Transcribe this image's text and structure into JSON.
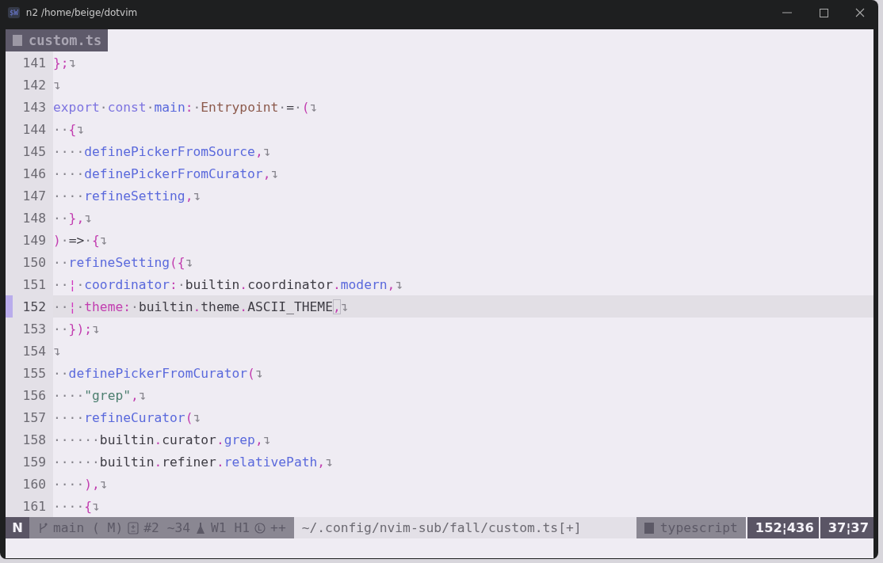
{
  "window": {
    "app_badge": "$W",
    "title": "n2 /home/beige/dotvim"
  },
  "tabs": [
    {
      "label": "custom.ts",
      "selected": true
    }
  ],
  "editor": {
    "lines": [
      {
        "number": "141",
        "current": false,
        "tokens": [
          {
            "kind": "p",
            "text": "};"
          },
          {
            "kind": "w",
            "text": "↴"
          }
        ]
      },
      {
        "number": "142",
        "current": false,
        "tokens": [
          {
            "kind": "w",
            "text": "↴"
          }
        ]
      },
      {
        "number": "143",
        "current": false,
        "tokens": [
          {
            "kind": "k",
            "text": "export"
          },
          {
            "kind": "w",
            "text": "·"
          },
          {
            "kind": "k",
            "text": "const"
          },
          {
            "kind": "w",
            "text": "·"
          },
          {
            "kind": "f",
            "text": "main"
          },
          {
            "kind": "p",
            "text": ":"
          },
          {
            "kind": "w",
            "text": "·"
          },
          {
            "kind": "t",
            "text": "Entrypoint"
          },
          {
            "kind": "w",
            "text": "·"
          },
          {
            "kind": "n",
            "text": "="
          },
          {
            "kind": "w",
            "text": "·"
          },
          {
            "kind": "p",
            "text": "("
          },
          {
            "kind": "w",
            "text": "↴"
          }
        ]
      },
      {
        "number": "144",
        "current": false,
        "tokens": [
          {
            "kind": "w",
            "text": "··"
          },
          {
            "kind": "p",
            "text": "{"
          },
          {
            "kind": "w",
            "text": "↴"
          }
        ]
      },
      {
        "number": "145",
        "current": false,
        "tokens": [
          {
            "kind": "w",
            "text": "····"
          },
          {
            "kind": "f",
            "text": "definePickerFromSource"
          },
          {
            "kind": "p",
            "text": ","
          },
          {
            "kind": "w",
            "text": "↴"
          }
        ]
      },
      {
        "number": "146",
        "current": false,
        "tokens": [
          {
            "kind": "w",
            "text": "····"
          },
          {
            "kind": "f",
            "text": "definePickerFromCurator"
          },
          {
            "kind": "p",
            "text": ","
          },
          {
            "kind": "w",
            "text": "↴"
          }
        ]
      },
      {
        "number": "147",
        "current": false,
        "tokens": [
          {
            "kind": "w",
            "text": "····"
          },
          {
            "kind": "f",
            "text": "refineSetting"
          },
          {
            "kind": "p",
            "text": ","
          },
          {
            "kind": "w",
            "text": "↴"
          }
        ]
      },
      {
        "number": "148",
        "current": false,
        "tokens": [
          {
            "kind": "w",
            "text": "··"
          },
          {
            "kind": "p",
            "text": "},"
          },
          {
            "kind": "w",
            "text": "↴"
          }
        ]
      },
      {
        "number": "149",
        "current": false,
        "tokens": [
          {
            "kind": "p",
            "text": ")"
          },
          {
            "kind": "w",
            "text": "·"
          },
          {
            "kind": "n",
            "text": "=>"
          },
          {
            "kind": "w",
            "text": "·"
          },
          {
            "kind": "p",
            "text": "{"
          },
          {
            "kind": "w",
            "text": "↴"
          }
        ]
      },
      {
        "number": "150",
        "current": false,
        "tokens": [
          {
            "kind": "w",
            "text": "··"
          },
          {
            "kind": "f",
            "text": "refineSetting"
          },
          {
            "kind": "p",
            "text": "({"
          },
          {
            "kind": "w",
            "text": "↴"
          }
        ]
      },
      {
        "number": "151",
        "current": false,
        "tokens": [
          {
            "kind": "w",
            "text": "··"
          },
          {
            "kind": "g",
            "text": "¦"
          },
          {
            "kind": "w",
            "text": "·"
          },
          {
            "kind": "f",
            "text": "coordinator"
          },
          {
            "kind": "p",
            "text": ":"
          },
          {
            "kind": "w",
            "text": "·"
          },
          {
            "kind": "n",
            "text": "builtin"
          },
          {
            "kind": "p",
            "text": "."
          },
          {
            "kind": "n",
            "text": "coordinator"
          },
          {
            "kind": "p",
            "text": "."
          },
          {
            "kind": "f",
            "text": "modern"
          },
          {
            "kind": "p",
            "text": ","
          },
          {
            "kind": "w",
            "text": "↴"
          }
        ]
      },
      {
        "number": "152",
        "current": true,
        "tokens": [
          {
            "kind": "w",
            "text": "··"
          },
          {
            "kind": "g",
            "text": "¦"
          },
          {
            "kind": "w",
            "text": "·"
          },
          {
            "kind": "m",
            "text": "theme"
          },
          {
            "kind": "p",
            "text": ":"
          },
          {
            "kind": "w",
            "text": "·"
          },
          {
            "kind": "n",
            "text": "builtin"
          },
          {
            "kind": "p",
            "text": "."
          },
          {
            "kind": "n",
            "text": "theme"
          },
          {
            "kind": "p",
            "text": "."
          },
          {
            "kind": "n",
            "text": "ASCII_THEME"
          },
          {
            "kind": "c",
            "text": ","
          },
          {
            "kind": "w",
            "text": "↴"
          }
        ]
      },
      {
        "number": "153",
        "current": false,
        "tokens": [
          {
            "kind": "w",
            "text": "··"
          },
          {
            "kind": "p",
            "text": "});"
          },
          {
            "kind": "w",
            "text": "↴"
          }
        ]
      },
      {
        "number": "154",
        "current": false,
        "tokens": [
          {
            "kind": "w",
            "text": "↴"
          }
        ]
      },
      {
        "number": "155",
        "current": false,
        "tokens": [
          {
            "kind": "w",
            "text": "··"
          },
          {
            "kind": "f",
            "text": "definePickerFromCurator"
          },
          {
            "kind": "p",
            "text": "("
          },
          {
            "kind": "w",
            "text": "↴"
          }
        ]
      },
      {
        "number": "156",
        "current": false,
        "tokens": [
          {
            "kind": "w",
            "text": "····"
          },
          {
            "kind": "s",
            "text": "\"grep\""
          },
          {
            "kind": "p",
            "text": ","
          },
          {
            "kind": "w",
            "text": "↴"
          }
        ]
      },
      {
        "number": "157",
        "current": false,
        "tokens": [
          {
            "kind": "w",
            "text": "····"
          },
          {
            "kind": "f",
            "text": "refineCurator"
          },
          {
            "kind": "p",
            "text": "("
          },
          {
            "kind": "w",
            "text": "↴"
          }
        ]
      },
      {
        "number": "158",
        "current": false,
        "tokens": [
          {
            "kind": "w",
            "text": "······"
          },
          {
            "kind": "n",
            "text": "builtin"
          },
          {
            "kind": "p",
            "text": "."
          },
          {
            "kind": "n",
            "text": "curator"
          },
          {
            "kind": "p",
            "text": "."
          },
          {
            "kind": "f",
            "text": "grep"
          },
          {
            "kind": "p",
            "text": ","
          },
          {
            "kind": "w",
            "text": "↴"
          }
        ]
      },
      {
        "number": "159",
        "current": false,
        "tokens": [
          {
            "kind": "w",
            "text": "······"
          },
          {
            "kind": "n",
            "text": "builtin"
          },
          {
            "kind": "p",
            "text": "."
          },
          {
            "kind": "n",
            "text": "refiner"
          },
          {
            "kind": "p",
            "text": "."
          },
          {
            "kind": "f",
            "text": "relativePath"
          },
          {
            "kind": "p",
            "text": ","
          },
          {
            "kind": "w",
            "text": "↴"
          }
        ]
      },
      {
        "number": "160",
        "current": false,
        "tokens": [
          {
            "kind": "w",
            "text": "····"
          },
          {
            "kind": "p",
            "text": "),"
          },
          {
            "kind": "w",
            "text": "↴"
          }
        ]
      },
      {
        "number": "161",
        "current": false,
        "tokens": [
          {
            "kind": "w",
            "text": "····"
          },
          {
            "kind": "p",
            "text": "{"
          },
          {
            "kind": "w",
            "text": "↴"
          }
        ]
      }
    ]
  },
  "status_bar": {
    "mode": "N",
    "git": [
      {
        "kind": "branch",
        "text": "main ( M)"
      },
      {
        "kind": "diff",
        "text": "#2 ~34"
      },
      {
        "kind": "flask",
        "text": "W1 H1"
      },
      {
        "kind": "clock",
        "text": "++"
      }
    ],
    "path": "~/.config/nvim-sub/fall/custom.ts[+]",
    "filetype": "typescript",
    "line": "152¦436",
    "column": "37¦37"
  }
}
